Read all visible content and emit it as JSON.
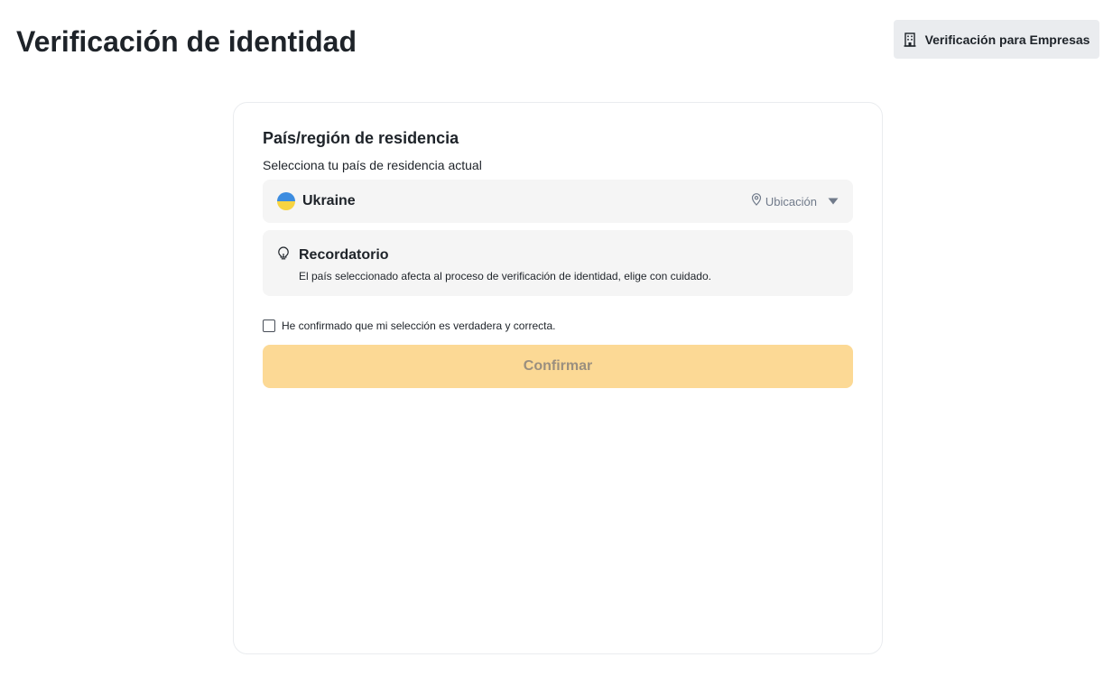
{
  "header": {
    "title": "Verificación de identidad",
    "business_button_label": "Verificación para Empresas"
  },
  "form": {
    "section_title": "País/región de residencia",
    "subtitle": "Selecciona tu país de residencia actual",
    "country": {
      "selected": "Ukraine",
      "location_label": "Ubicación"
    },
    "reminder": {
      "title": "Recordatorio",
      "text": "El país seleccionado afecta al proceso de verificación de identidad, elige con cuidado."
    },
    "confirmation_checkbox_label": "He confirmado que mi selección es verdadera y correcta.",
    "confirmation_checked": false,
    "confirm_button_label": "Confirmar"
  },
  "colors": {
    "confirm_button_disabled": "#fcd995",
    "field_background": "#f5f5f5",
    "business_button_background": "#eaecef",
    "flag_blue": "#3c8ce0",
    "flag_yellow": "#f7d442"
  },
  "icons": {
    "business_button": "building-icon",
    "country_flag": "ukraine-flag-icon",
    "location": "map-pin-icon",
    "dropdown": "caret-down-icon",
    "reminder": "lightbulb-icon"
  }
}
